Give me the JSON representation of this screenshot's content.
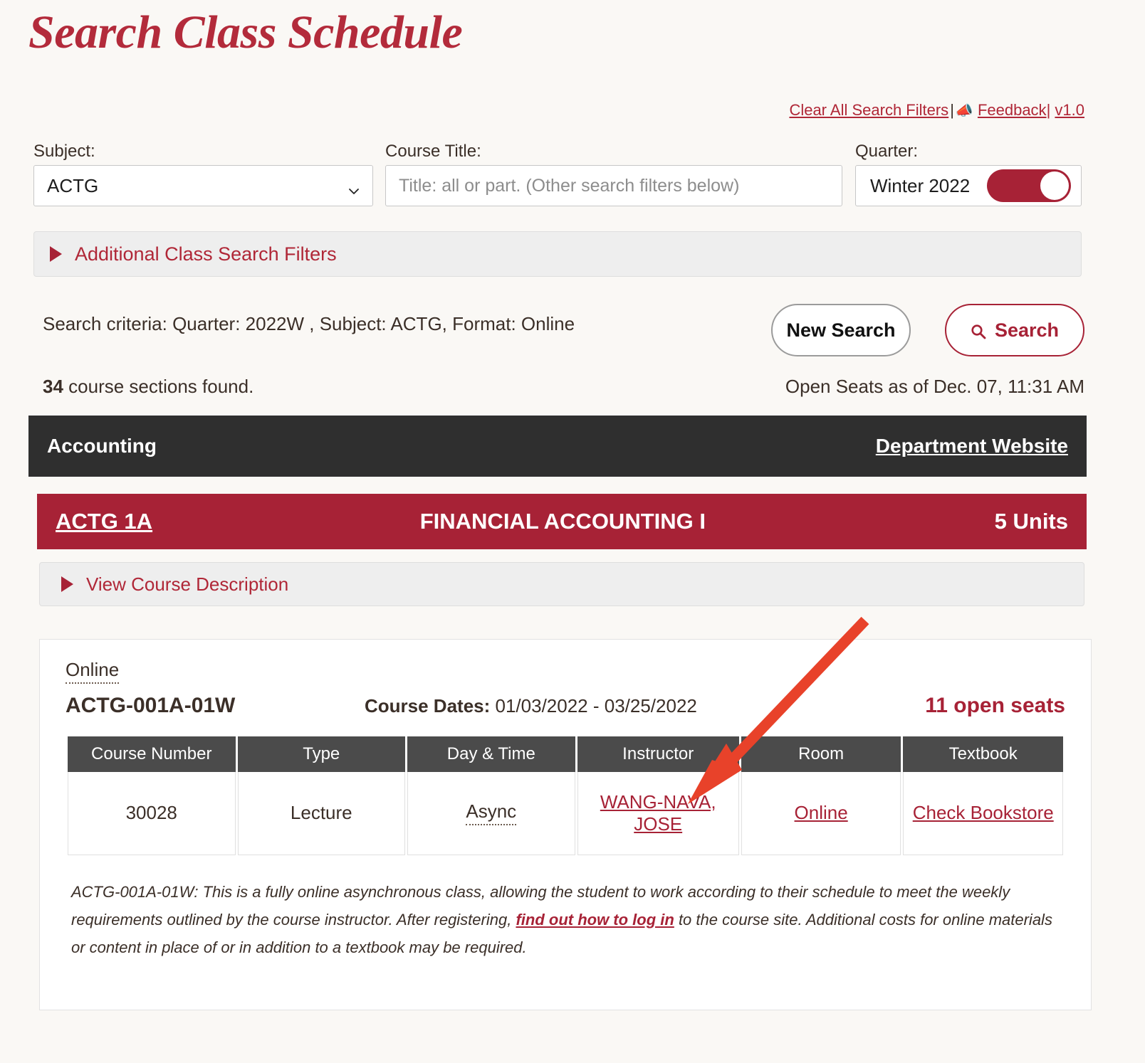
{
  "page": {
    "title": "Search Class Schedule"
  },
  "toplinks": {
    "clear_filters": "Clear All Search Filters",
    "separator": "|",
    "feedback_icon": "megaphone-icon",
    "feedback_glyph": "📣",
    "feedback": "Feedback",
    "version": "v1.0"
  },
  "filters": {
    "subject": {
      "label": "Subject:",
      "value": "ACTG",
      "chevron_icon": "chevron-down-icon"
    },
    "course_title": {
      "label": "Course Title:",
      "value": "",
      "placeholder": "Title: all or part. (Other search filters below)"
    },
    "quarter": {
      "label": "Quarter:",
      "value": "Winter 2022",
      "toggle_state": "on"
    },
    "additional": {
      "label": "Additional Class Search Filters",
      "triangle_icon": "triangle-right-icon",
      "expanded": false
    }
  },
  "results": {
    "criteria": "Search criteria: Quarter: 2022W , Subject: ACTG, Format: Online",
    "new_search_label": "New Search",
    "search_label": "Search",
    "search_icon": "magnifier-icon",
    "count_number": "34",
    "count_text": " course sections found.",
    "open_seats_asof": "Open Seats as of Dec. 07, 11:31 AM"
  },
  "department": {
    "name": "Accounting",
    "website_link": "Department Website"
  },
  "course": {
    "code": "ACTG 1A",
    "name": "FINANCIAL ACCOUNTING I",
    "units": "5 Units",
    "description_toggle": "View Course Description",
    "description_triangle_icon": "triangle-right-icon"
  },
  "section": {
    "modality": "Online",
    "section_id": "ACTG-001A-01W",
    "dates_label": "Course Dates:",
    "dates_value": " 01/03/2022 - 03/25/2022",
    "open_seats": "11 open seats",
    "table": {
      "headers": [
        "Course Number",
        "Type",
        "Day & Time",
        "Instructor",
        "Room",
        "Textbook"
      ],
      "row": {
        "course_number": "30028",
        "type": "Lecture",
        "day_time": "Async",
        "instructor": "WANG-NAVA, JOSE",
        "room": "Online",
        "textbook": "Check Bookstore"
      }
    },
    "note": {
      "part1": "ACTG-001A-01W: This is a fully online asynchronous class, allowing the student to work according to their schedule to meet the weekly requirements outlined by the course instructor. After registering, ",
      "link": "find out how to log in",
      "part2": " to the course site. Additional costs for online materials or content in place of or in addition to a textbook may be required."
    }
  },
  "annotation": {
    "arrow_icon": "arrow-pointer-annotation",
    "color": "#e8422a",
    "points_to": "instructor-link"
  },
  "colors": {
    "brand_red": "#a72236",
    "title_red": "#b32b3b",
    "dark_bar": "#2f2f2f",
    "table_header": "#4b4b4b",
    "page_bg": "#faf8f5",
    "annotation_red": "#e8422a"
  }
}
